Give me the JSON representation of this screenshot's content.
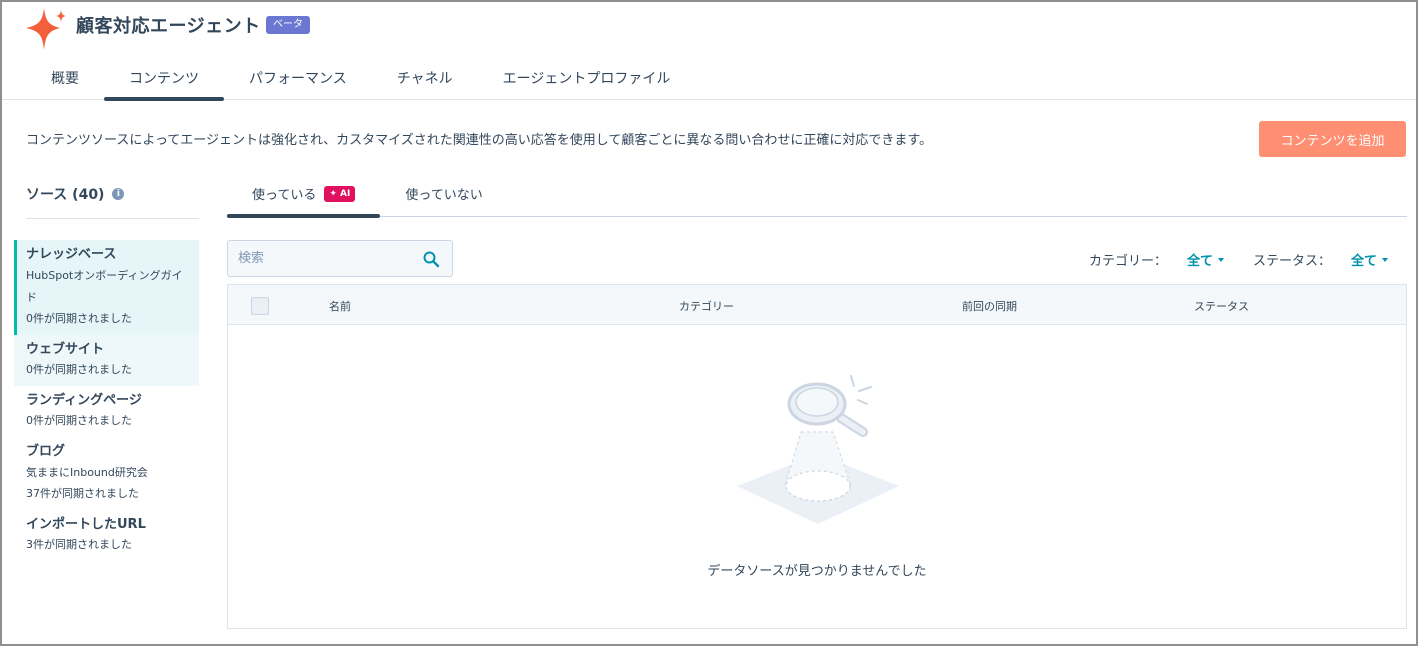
{
  "header": {
    "title": "顧客対応エージェント",
    "beta_badge": "ベータ",
    "tabs": [
      {
        "label": "概要"
      },
      {
        "label": "コンテンツ"
      },
      {
        "label": "パフォーマンス"
      },
      {
        "label": "チャネル"
      },
      {
        "label": "エージェントプロファイル"
      }
    ],
    "active_tab_index": 1,
    "logo_color": "#f25f3a"
  },
  "description": "コンテンツソースによってエージェントは強化され、カスタマイズされた関連性の高い応答を使用して顧客ごとに異なる問い合わせに正確に対応できます。",
  "add_content_button": "コンテンツを追加",
  "sidebar": {
    "header": "ソース (40)",
    "info_icon": "i",
    "items": [
      {
        "title": "ナレッジベース",
        "subtitle": "HubSpotオンボーディングガイド",
        "count": "0件が同期されました"
      },
      {
        "title": "ウェブサイト",
        "subtitle": "",
        "count": "0件が同期されました"
      },
      {
        "title": "ランディングページ",
        "subtitle": "",
        "count": "0件が同期されました"
      },
      {
        "title": "ブログ",
        "subtitle": "気ままにInbound研究会",
        "count": "37件が同期されました"
      },
      {
        "title": "インポートしたURL",
        "subtitle": "",
        "count": "3件が同期されました"
      }
    ]
  },
  "sub_tabs": {
    "in_use": "使っている",
    "ai_badge": "✦ AI",
    "not_in_use": "使っていない"
  },
  "search": {
    "placeholder": "検索"
  },
  "filters": {
    "category_label": "カテゴリー：",
    "category_value": "全て",
    "status_label": "ステータス：",
    "status_value": "全て"
  },
  "table": {
    "columns": [
      "名前",
      "カテゴリー",
      "前回の同期",
      "ステータス"
    ],
    "empty_message": "データソースが見つかりませんでした"
  },
  "colors": {
    "accent": "#ff8f73",
    "link": "#0091ae",
    "beta": "#6a78d1",
    "ai": "#e0115f",
    "active_item_bg": "#e5f5f8",
    "active_item_border": "#00bda5"
  }
}
